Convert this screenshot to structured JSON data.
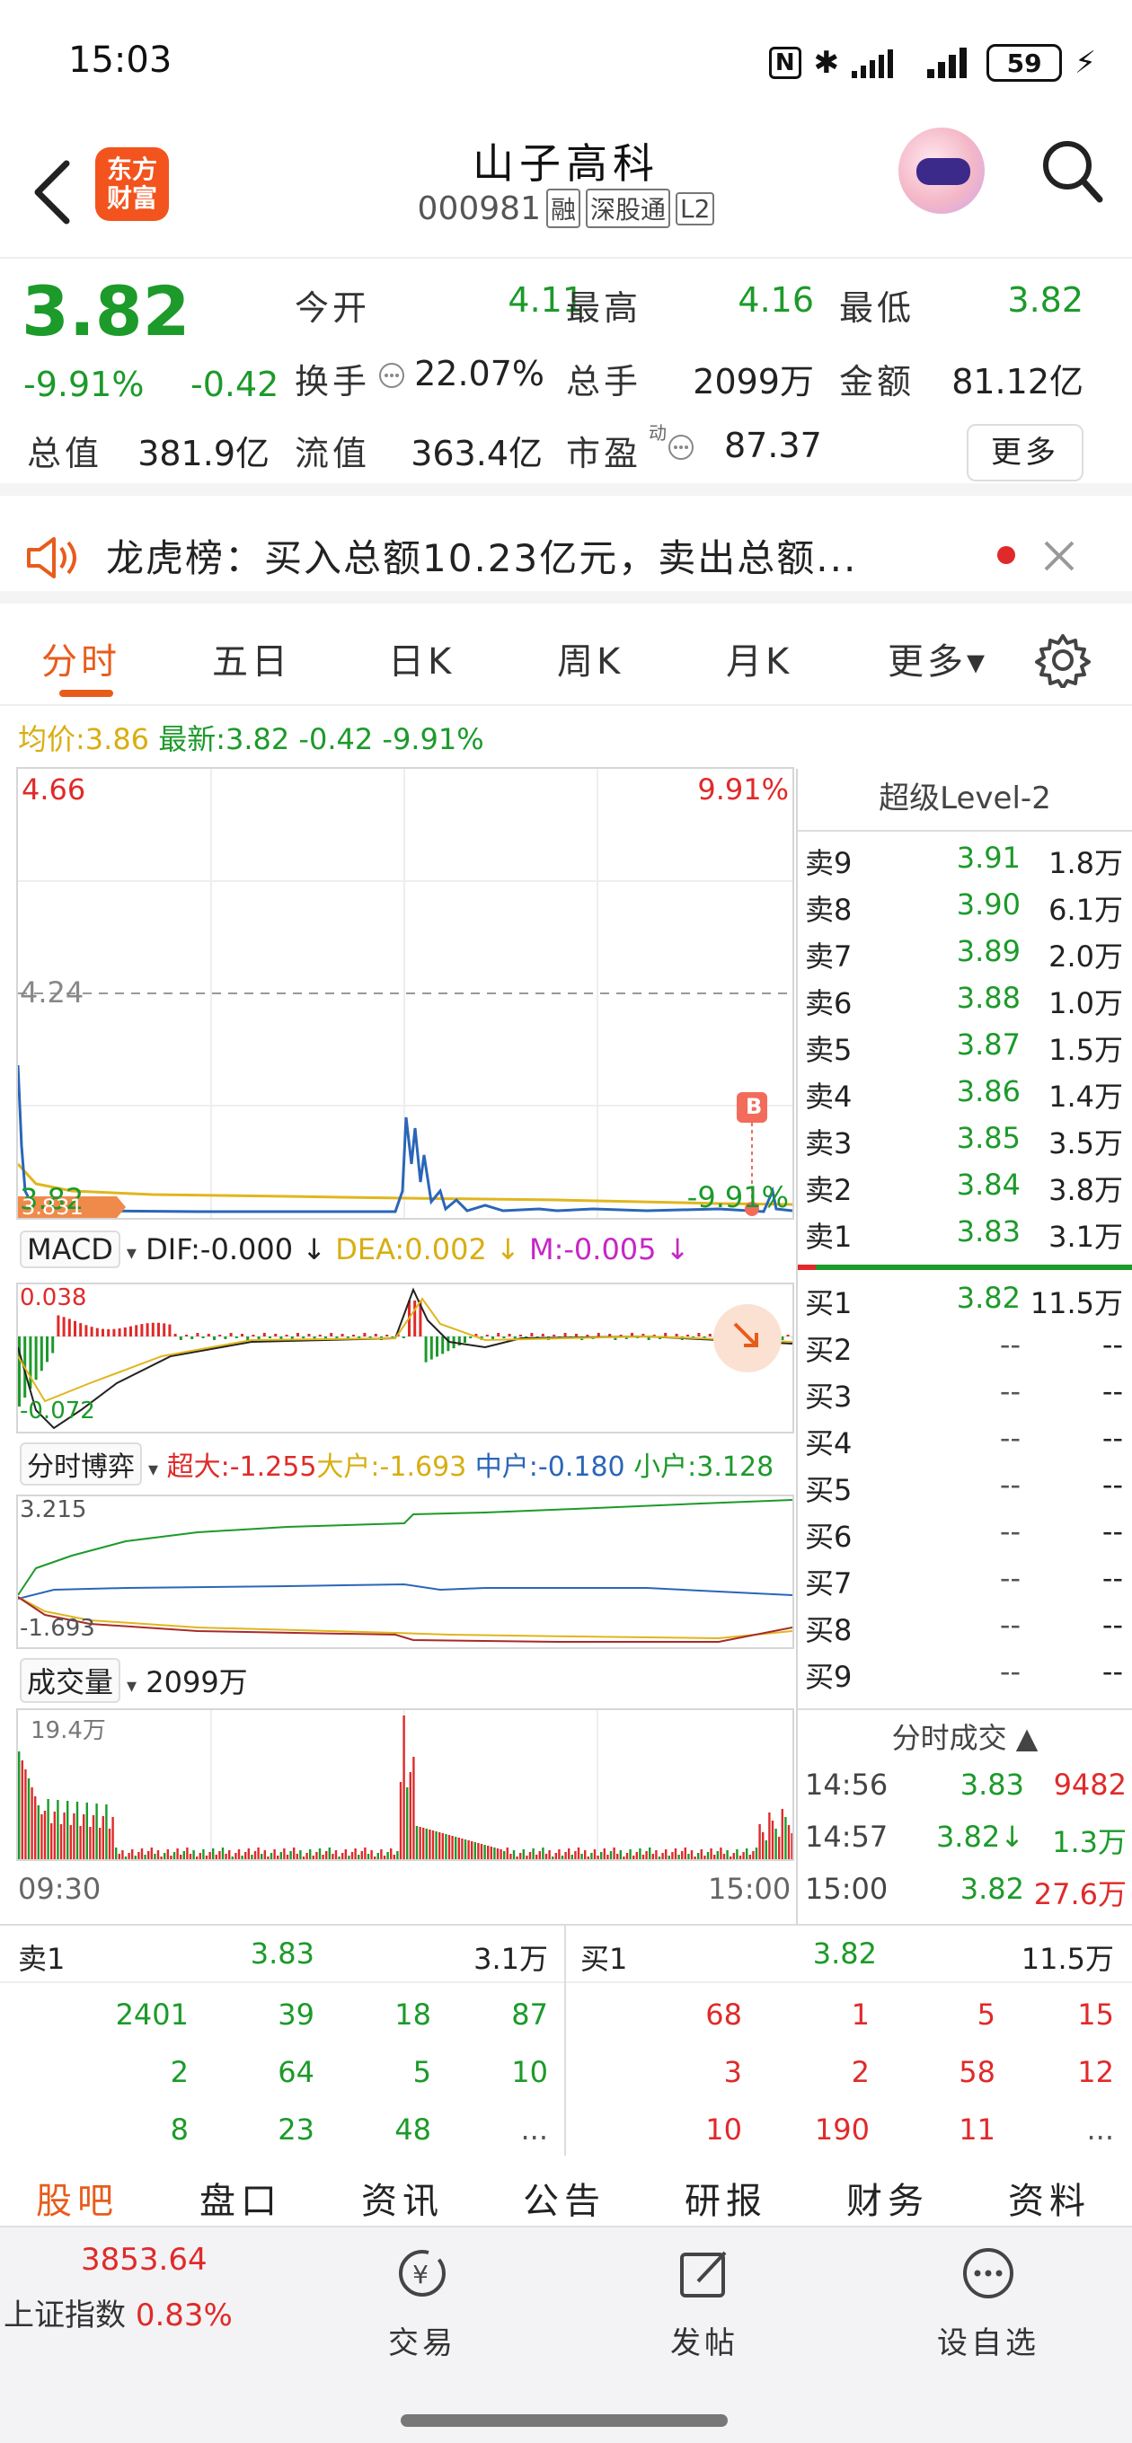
{
  "status_bar": {
    "time": "15:03",
    "nfc": "N",
    "bluetooth": "✱",
    "battery": "59",
    "charging": "⚡"
  },
  "header": {
    "logo": "东方\n财富",
    "stock_name": "山子高科",
    "code": "000981",
    "tags": [
      "融",
      "深股通",
      "L2"
    ]
  },
  "quote": {
    "price": "3.82",
    "pct": "-9.91%",
    "change": "-0.42",
    "fields": [
      {
        "label": "今开",
        "value": "4.11",
        "color": "green"
      },
      {
        "label": "最高",
        "value": "4.16",
        "color": "green"
      },
      {
        "label": "最低",
        "value": "3.82",
        "color": "green"
      },
      {
        "label": "换手",
        "value": "22.07%",
        "color": "black"
      },
      {
        "label": "总手",
        "value": "2099万",
        "color": "black"
      },
      {
        "label": "金额",
        "value": "81.12亿",
        "color": "black"
      },
      {
        "label": "总值",
        "value": "381.9亿",
        "color": "black"
      },
      {
        "label": "流值",
        "value": "363.4亿",
        "color": "black"
      },
      {
        "label": "市盈",
        "value": "87.37",
        "color": "black",
        "superscript": "动"
      }
    ],
    "more": "更多"
  },
  "news": {
    "text": "龙虎榜：买入总额10.23亿元，卖出总额..."
  },
  "tabs": [
    "分时",
    "五日",
    "日K",
    "周K",
    "月K",
    "更多▾"
  ],
  "avg_line": {
    "avg": "均价:3.86",
    "latest": "最新:3.82 -0.42 -9.91%"
  },
  "price_chart": {
    "top_left": "4.66",
    "top_right": "9.91%",
    "mid": "4.24",
    "bottom_left": "3.82",
    "bottom_right": "-9.91%",
    "marker": "3.831",
    "b_marker": "B"
  },
  "macd": {
    "name": "MACD",
    "dif": "DIF:-0.000 ↓",
    "dea": "DEA:0.002 ↓",
    "m": "M:-0.005 ↓",
    "top": "0.038",
    "bottom": "-0.072"
  },
  "fund_flow": {
    "name": "分时博弈",
    "super": "超大:-1.255",
    "large": "大户:-1.693",
    "mid": "中户:-0.180",
    "small": "小户:3.128",
    "top": "3.215",
    "bottom": "-1.693"
  },
  "volume": {
    "name": "成交量",
    "total": "2099万",
    "top": "19.4万",
    "start_time": "09:30",
    "end_time": "15:00"
  },
  "order_book": {
    "title": "超级Level-2",
    "asks": [
      {
        "label": "卖9",
        "price": "3.91",
        "vol": "1.8万"
      },
      {
        "label": "卖8",
        "price": "3.90",
        "vol": "6.1万"
      },
      {
        "label": "卖7",
        "price": "3.89",
        "vol": "2.0万"
      },
      {
        "label": "卖6",
        "price": "3.88",
        "vol": "1.0万"
      },
      {
        "label": "卖5",
        "price": "3.87",
        "vol": "1.5万"
      },
      {
        "label": "卖4",
        "price": "3.86",
        "vol": "1.4万"
      },
      {
        "label": "卖3",
        "price": "3.85",
        "vol": "3.5万"
      },
      {
        "label": "卖2",
        "price": "3.84",
        "vol": "3.8万"
      },
      {
        "label": "卖1",
        "price": "3.83",
        "vol": "3.1万"
      }
    ],
    "bids": [
      {
        "label": "买1",
        "price": "3.82",
        "vol": "11.5万"
      },
      {
        "label": "买2",
        "price": "--",
        "vol": "--"
      },
      {
        "label": "买3",
        "price": "--",
        "vol": "--"
      },
      {
        "label": "买4",
        "price": "--",
        "vol": "--"
      },
      {
        "label": "买5",
        "price": "--",
        "vol": "--"
      },
      {
        "label": "买6",
        "price": "--",
        "vol": "--"
      },
      {
        "label": "买7",
        "price": "--",
        "vol": "--"
      },
      {
        "label": "买8",
        "price": "--",
        "vol": "--"
      },
      {
        "label": "买9",
        "price": "--",
        "vol": "--"
      }
    ],
    "trades_title": "分时成交 ▲",
    "trades": [
      {
        "time": "14:56",
        "price": "3.83",
        "vol": "9482"
      },
      {
        "time": "14:57",
        "price": "3.82↓",
        "vol": "1.3万"
      },
      {
        "time": "15:00",
        "price": "3.82",
        "vol": "27.6万"
      }
    ]
  },
  "order_grid": {
    "sell_label": "卖1",
    "sell_price": "3.83",
    "sell_vol": "3.1万",
    "buy_label": "买1",
    "buy_price": "3.82",
    "buy_vol": "11.5万",
    "sell_rows": [
      [
        "2401",
        "39",
        "18",
        "87"
      ],
      [
        "2",
        "64",
        "5",
        "10"
      ],
      [
        "8",
        "23",
        "48",
        "..."
      ]
    ],
    "buy_rows": [
      [
        "68",
        "1",
        "5",
        "15"
      ],
      [
        "3",
        "2",
        "58",
        "12"
      ],
      [
        "10",
        "190",
        "11",
        "..."
      ]
    ]
  },
  "bottom_tabs": [
    "股吧",
    "盘口",
    "资讯",
    "公告",
    "研报",
    "财务",
    "资料"
  ],
  "navbar": {
    "index_value": "3853.64",
    "index_name": "上证指数",
    "index_pct": "0.83%",
    "items": [
      "交易",
      "发帖",
      "设自选"
    ]
  },
  "colors": {
    "up": "#e02a2a",
    "down": "#1c9a2a",
    "accent": "#e85c1b",
    "avg": "#d8ae12",
    "price_line": "#2a66b8"
  }
}
